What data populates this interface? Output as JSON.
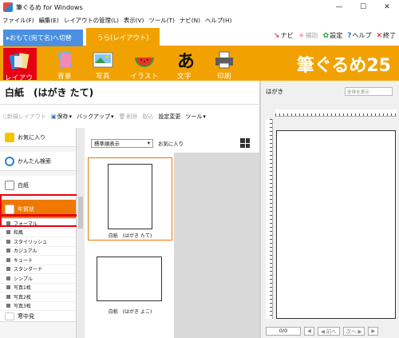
{
  "window": {
    "title": "筆ぐるめ for Windows",
    "minimize": "—",
    "maximize": "☐",
    "close": "✕"
  },
  "menu": [
    "ファイル(F)",
    "編集(E)",
    "レイアウトの管理(L)",
    "表示(V)",
    "ツール(T)",
    "ナビ(N)",
    "ヘルプ(H)"
  ],
  "tabs": {
    "address": "▸おもて(宛て名)へ切替",
    "layout": "うら(レイアウト)"
  },
  "tools": {
    "navi": "ナビ",
    "assist": "補助",
    "settings": "設定",
    "help": "ヘルプ",
    "exit": "終了"
  },
  "ribbon": {
    "layout": "レイアウト",
    "background": "背景",
    "photo": "写真",
    "illust": "イラスト",
    "text": "文字",
    "print": "印刷",
    "brand": "筆ぐるめ25"
  },
  "main": {
    "title": "白紙　(はがき たて)",
    "toolbar": {
      "new_layout": "新規レイアウト",
      "save": "保存",
      "backup": "バックアップ",
      "delete": "削除",
      "import": "取込",
      "settings_change": "設定変更",
      "tools": "ツール"
    }
  },
  "sidebar": {
    "categories": [
      {
        "label": "お気に入り",
        "icon": "favorite-icon"
      },
      {
        "label": "かんたん検索",
        "icon": "search-icon"
      },
      {
        "label": "白紙",
        "icon": "blank-icon"
      },
      {
        "label": "年賀状",
        "icon": "nengajo-icon"
      }
    ],
    "subitems": [
      "フォーマル",
      "和風",
      "スタイリッシュ",
      "カジュアル",
      "キュート",
      "スタンダード",
      "シンプル",
      "写真1枚",
      "写真2枚",
      "写真3枚"
    ],
    "next_category": "寒中見"
  },
  "templates": {
    "sort_select": "標準順表示",
    "favorites": "お気に入り",
    "items": [
      {
        "caption": "白紙　(はがき たて)"
      },
      {
        "caption": "白紙　(はがき よこ)"
      }
    ]
  },
  "preview": {
    "title": "はがき",
    "zoom_placeholder": "全体を表示",
    "page_counter": "0/0",
    "prev": "◀ 前へ",
    "next": "次へ ▶"
  },
  "colors": {
    "accent_orange": "#f2a200",
    "highlight_red": "#e60012",
    "tab_blue": "#4a8fe0"
  }
}
